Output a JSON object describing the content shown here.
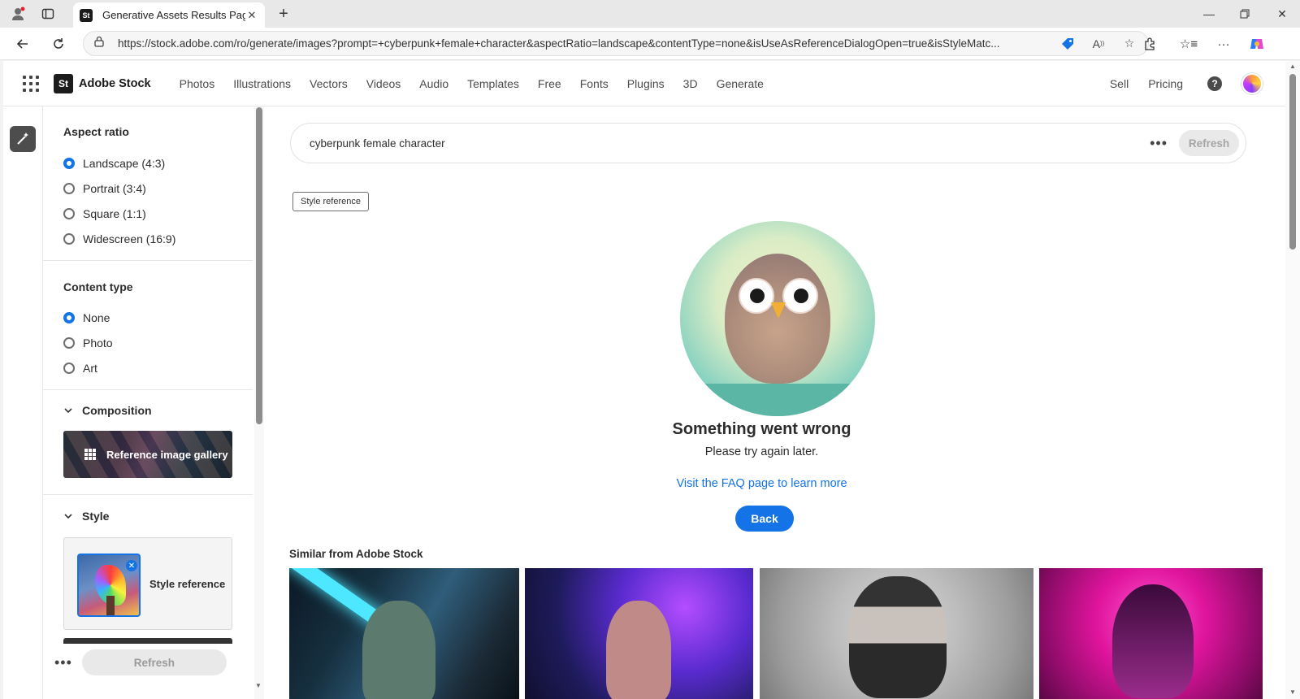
{
  "browser": {
    "tab_title": "Generative Assets Results Page",
    "tab_favicon": "St",
    "url": "https://stock.adobe.com/ro/generate/images?prompt=+cyberpunk+female+character&aspectRatio=landscape&contentType=none&isUseAsReferenceDialogOpen=true&isStyleMatc..."
  },
  "header": {
    "logo_badge": "St",
    "logo_text": "Adobe Stock",
    "nav": [
      "Photos",
      "Illustrations",
      "Vectors",
      "Videos",
      "Audio",
      "Templates",
      "Free",
      "Fonts",
      "Plugins",
      "3D",
      "Generate"
    ],
    "sell": "Sell",
    "pricing": "Pricing",
    "help": "?"
  },
  "filters": {
    "aspect_ratio": {
      "title": "Aspect ratio",
      "options": [
        "Landscape (4:3)",
        "Portrait (3:4)",
        "Square (1:1)",
        "Widescreen (16:9)"
      ],
      "selected": "Landscape (4:3)"
    },
    "content_type": {
      "title": "Content type",
      "options": [
        "None",
        "Photo",
        "Art"
      ],
      "selected": "None"
    },
    "composition": {
      "title": "Composition",
      "gallery_label": "Reference image gallery"
    },
    "style": {
      "title": "Style",
      "reference_label": "Style reference"
    },
    "footer": {
      "more": "•••",
      "refresh": "Refresh"
    }
  },
  "main": {
    "prompt": "cyberpunk female character",
    "more": "•••",
    "refresh": "Refresh",
    "tag": "Style reference",
    "error": {
      "title": "Something went wrong",
      "subtitle": "Please try again later.",
      "link": "Visit the FAQ page to learn more",
      "back": "Back"
    },
    "similar_title": "Similar from Adobe Stock"
  },
  "colors": {
    "accent": "#1473e6",
    "text": "#2c2c2c"
  }
}
